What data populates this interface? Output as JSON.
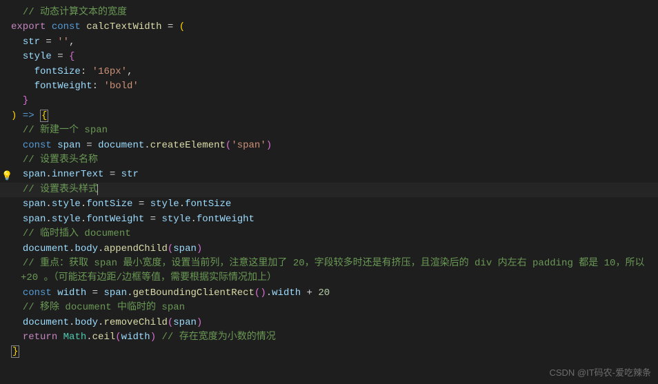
{
  "lines": {
    "c1": "// 动态计算文本的宽度",
    "l2": {
      "export": "export",
      "const": "const",
      "name": "calcTextWidth",
      "eq": " = ",
      "paren": "("
    },
    "l3": {
      "str": "str",
      "eq": " = ",
      "val": "''",
      "comma": ","
    },
    "l4": {
      "style": "style",
      "eq": " = ",
      "brace": "{"
    },
    "l5": {
      "key": "fontSize",
      "colon": ": ",
      "val": "'16px'",
      "comma": ","
    },
    "l6": {
      "key": "fontWeight",
      "colon": ": ",
      "val": "'bold'"
    },
    "l7": {
      "brace": "}"
    },
    "l8": {
      "paren": ")",
      "arrow": " => ",
      "brace": "{"
    },
    "c9": "// 新建一个 span",
    "l10": {
      "const": "const",
      "span": "span",
      "eq": " = ",
      "doc": "document",
      "dot": ".",
      "method": "createElement",
      "po": "(",
      "arg": "'span'",
      "pc": ")"
    },
    "c11": "// 设置表头名称",
    "l12": {
      "span": "span",
      "dot": ".",
      "prop": "innerText",
      "eq": " = ",
      "str": "str"
    },
    "c13": "// 设置表头样式",
    "l14": {
      "span": "span",
      "d1": ".",
      "style": "style",
      "d2": ".",
      "prop": "fontSize",
      "eq": " = ",
      "style2": "style",
      "d3": ".",
      "prop2": "fontSize"
    },
    "l15": {
      "span": "span",
      "d1": ".",
      "style": "style",
      "d2": ".",
      "prop": "fontWeight",
      "eq": " = ",
      "style2": "style",
      "d3": ".",
      "prop2": "fontWeight"
    },
    "c16": "// 临时插入 document",
    "l17": {
      "doc": "document",
      "d1": ".",
      "body": "body",
      "d2": ".",
      "method": "appendChild",
      "po": "(",
      "arg": "span",
      "pc": ")"
    },
    "c18": "// 重点：获取 span 最小宽度，设置当前列，注意这里加了 20，字段较多时还是有挤压，且渲染后的 div 内左右 padding 都是 10，所以 +20 。（可能还有边距/边框等值，需要根据实际情况加上）",
    "l19": {
      "const": "const",
      "width": "width",
      "eq": " = ",
      "span": "span",
      "d1": ".",
      "method": "getBoundingClientRect",
      "po": "(",
      "pc": ")",
      "d2": ".",
      "prop": "width",
      "plus": " + ",
      "num": "20"
    },
    "c20": "// 移除 document 中临时的 span",
    "l21": {
      "doc": "document",
      "d1": ".",
      "body": "body",
      "d2": ".",
      "method": "removeChild",
      "po": "(",
      "arg": "span",
      "pc": ")"
    },
    "l22": {
      "return": "return",
      "math": "Math",
      "d1": ".",
      "method": "ceil",
      "po": "(",
      "arg": "width",
      "pc": ")",
      "comment": " // 存在宽度为小数的情况"
    },
    "l23": {
      "brace": "}"
    }
  },
  "watermark": "CSDN @IT码农-爱吃辣条"
}
